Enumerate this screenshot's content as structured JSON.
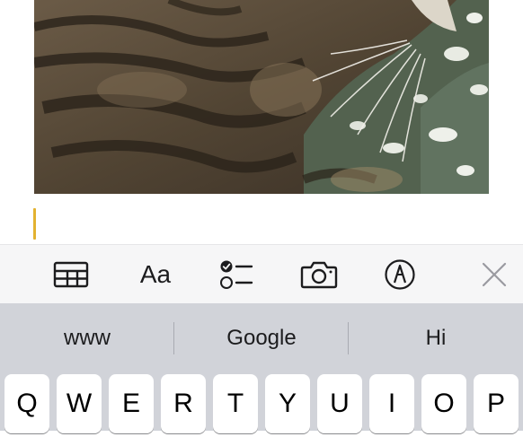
{
  "toolbar": {
    "format_label": "Aa",
    "icons": [
      "table-icon",
      "checklist-icon",
      "camera-icon",
      "markup-pen-icon",
      "close-icon"
    ]
  },
  "suggestions": [
    "www",
    "Google",
    "Hi"
  ],
  "keyboard": {
    "row1": [
      "Q",
      "W",
      "E",
      "R",
      "T",
      "Y",
      "U",
      "I",
      "O",
      "P"
    ]
  },
  "colors": {
    "cursor": "#e3b230",
    "toolbar_bg": "#f6f6f7",
    "keyboard_bg": "#d1d3d9",
    "key_bg": "#ffffff"
  }
}
